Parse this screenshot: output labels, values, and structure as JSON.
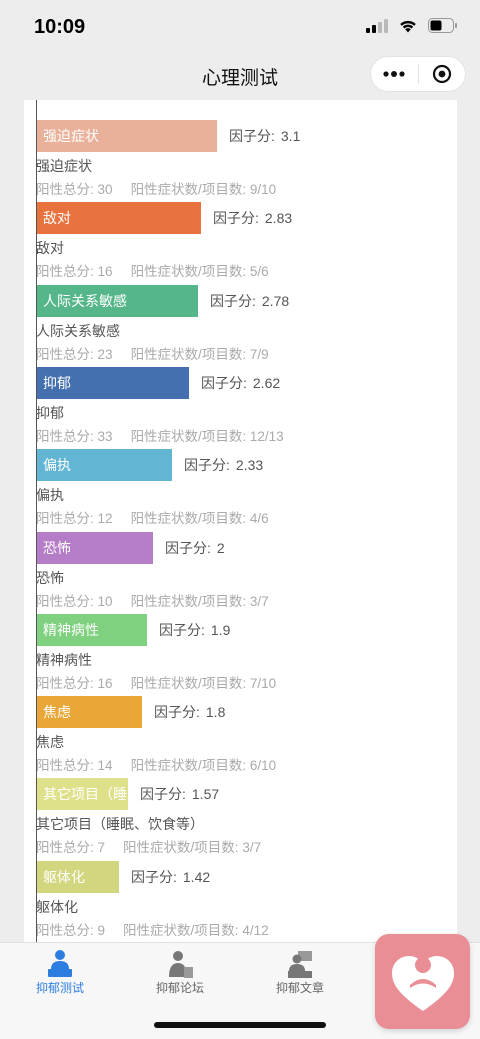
{
  "status": {
    "time": "10:09"
  },
  "nav": {
    "title": "心理测试"
  },
  "labels": {
    "factor": "因子分:",
    "pos_total": "阳性总分:",
    "pos_ratio": "阳性症状数/项目数:"
  },
  "items": [
    {
      "bar_label": "强迫症状",
      "name": "强迫症状",
      "factor": "3.1",
      "pos_total": "30",
      "ratio": "9/10",
      "color": "#e9b19a"
    },
    {
      "bar_label": "敌对",
      "name": "敌对",
      "factor": "2.83",
      "pos_total": "16",
      "ratio": "5/6",
      "color": "#e8733f"
    },
    {
      "bar_label": "人际关系敏感",
      "name": "人际关系敏感",
      "factor": "2.78",
      "pos_total": "23",
      "ratio": "7/9",
      "color": "#55b689"
    },
    {
      "bar_label": "抑郁",
      "name": "抑郁",
      "factor": "2.62",
      "pos_total": "33",
      "ratio": "12/13",
      "color": "#4470b0"
    },
    {
      "bar_label": "偏执",
      "name": "偏执",
      "factor": "2.33",
      "pos_total": "12",
      "ratio": "4/6",
      "color": "#62b5d3"
    },
    {
      "bar_label": "恐怖",
      "name": "恐怖",
      "factor": "2",
      "pos_total": "10",
      "ratio": "3/7",
      "color": "#b57cc7"
    },
    {
      "bar_label": "精神病性",
      "name": "精神病性",
      "factor": "1.9",
      "pos_total": "16",
      "ratio": "7/10",
      "color": "#7fd17f"
    },
    {
      "bar_label": "焦虑",
      "name": "焦虑",
      "factor": "1.8",
      "pos_total": "14",
      "ratio": "6/10",
      "color": "#e8a736"
    },
    {
      "bar_label": "其它项目（睡",
      "name": "其它项目（睡眠、饮食等）",
      "factor": "1.57",
      "pos_total": "7",
      "ratio": "3/7",
      "color": "#dfe08a"
    },
    {
      "bar_label": "躯体化",
      "name": "躯体化",
      "factor": "1.42",
      "pos_total": "9",
      "ratio": "4/12",
      "color": "#d2d67f"
    }
  ],
  "tabs": [
    {
      "label": "抑郁测试",
      "icon": "person-desk-icon",
      "active": true
    },
    {
      "label": "抑郁论坛",
      "icon": "person-forum-icon",
      "active": false
    },
    {
      "label": "抑郁文章",
      "icon": "person-article-icon",
      "active": false
    }
  ],
  "float_button": {
    "icon": "heart-person-icon",
    "color": "#ea8e95"
  }
}
